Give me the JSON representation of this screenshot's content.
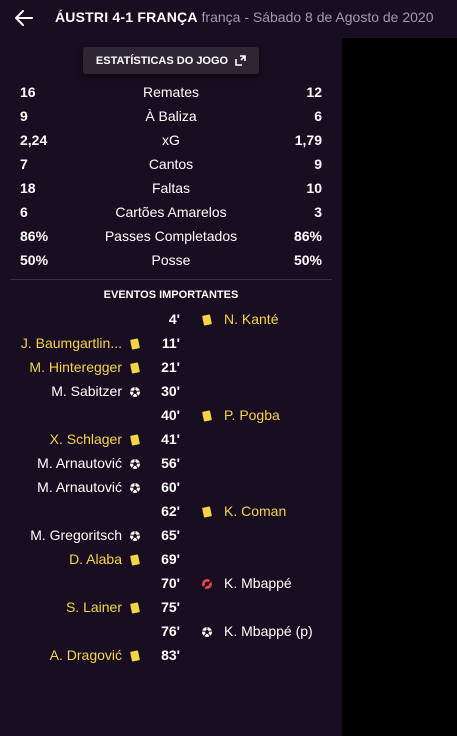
{
  "header": {
    "teams": "ÁUSTRI 4-1 FRANÇA",
    "subtitle": "frança - Sábado 8 de Agosto de 2020"
  },
  "stats_button": {
    "label": "ESTATÍSTICAS DO JOGO"
  },
  "stats": [
    {
      "home": "16",
      "label": "Remates",
      "away": "12"
    },
    {
      "home": "9",
      "label": "À Baliza",
      "away": "6"
    },
    {
      "home": "2,24",
      "label": "xG",
      "away": "1,79"
    },
    {
      "home": "7",
      "label": "Cantos",
      "away": "9"
    },
    {
      "home": "18",
      "label": "Faltas",
      "away": "10"
    },
    {
      "home": "6",
      "label": "Cartões Amarelos",
      "away": "3"
    },
    {
      "home": "86%",
      "label": "Passes Completados",
      "away": "86%"
    },
    {
      "home": "50%",
      "label": "Posse",
      "away": "50%"
    }
  ],
  "events_title": "EVENTOS IMPORTANTES",
  "events": [
    {
      "minute": "4'",
      "side": "away",
      "player": "N. Kanté",
      "type": "yellow-card"
    },
    {
      "minute": "11'",
      "side": "home",
      "player": "J. Baumgartlin...",
      "type": "yellow-card"
    },
    {
      "minute": "21'",
      "side": "home",
      "player": "M. Hinteregger",
      "type": "yellow-card"
    },
    {
      "minute": "30'",
      "side": "home",
      "player": "M. Sabitzer",
      "type": "goal"
    },
    {
      "minute": "40'",
      "side": "away",
      "player": "P. Pogba",
      "type": "yellow-card"
    },
    {
      "minute": "41'",
      "side": "home",
      "player": "X. Schlager",
      "type": "yellow-card"
    },
    {
      "minute": "56'",
      "side": "home",
      "player": "M. Arnautović",
      "type": "goal"
    },
    {
      "minute": "60'",
      "side": "home",
      "player": "M. Arnautović",
      "type": "goal"
    },
    {
      "minute": "62'",
      "side": "away",
      "player": "K. Coman",
      "type": "yellow-card"
    },
    {
      "minute": "65'",
      "side": "home",
      "player": "M. Gregoritsch",
      "type": "goal"
    },
    {
      "minute": "69'",
      "side": "home",
      "player": "D. Alaba",
      "type": "yellow-card"
    },
    {
      "minute": "70'",
      "side": "away",
      "player": "K. Mbappé",
      "type": "missed-penalty"
    },
    {
      "minute": "75'",
      "side": "home",
      "player": "S. Lainer",
      "type": "yellow-card"
    },
    {
      "minute": "76'",
      "side": "away",
      "player": "K. Mbappé (p)",
      "type": "goal"
    },
    {
      "minute": "83'",
      "side": "home",
      "player": "A. Dragović",
      "type": "yellow-card"
    }
  ],
  "colors": {
    "background": "#190d21",
    "yellow": "#f5d547",
    "missed": "#e0474c"
  }
}
